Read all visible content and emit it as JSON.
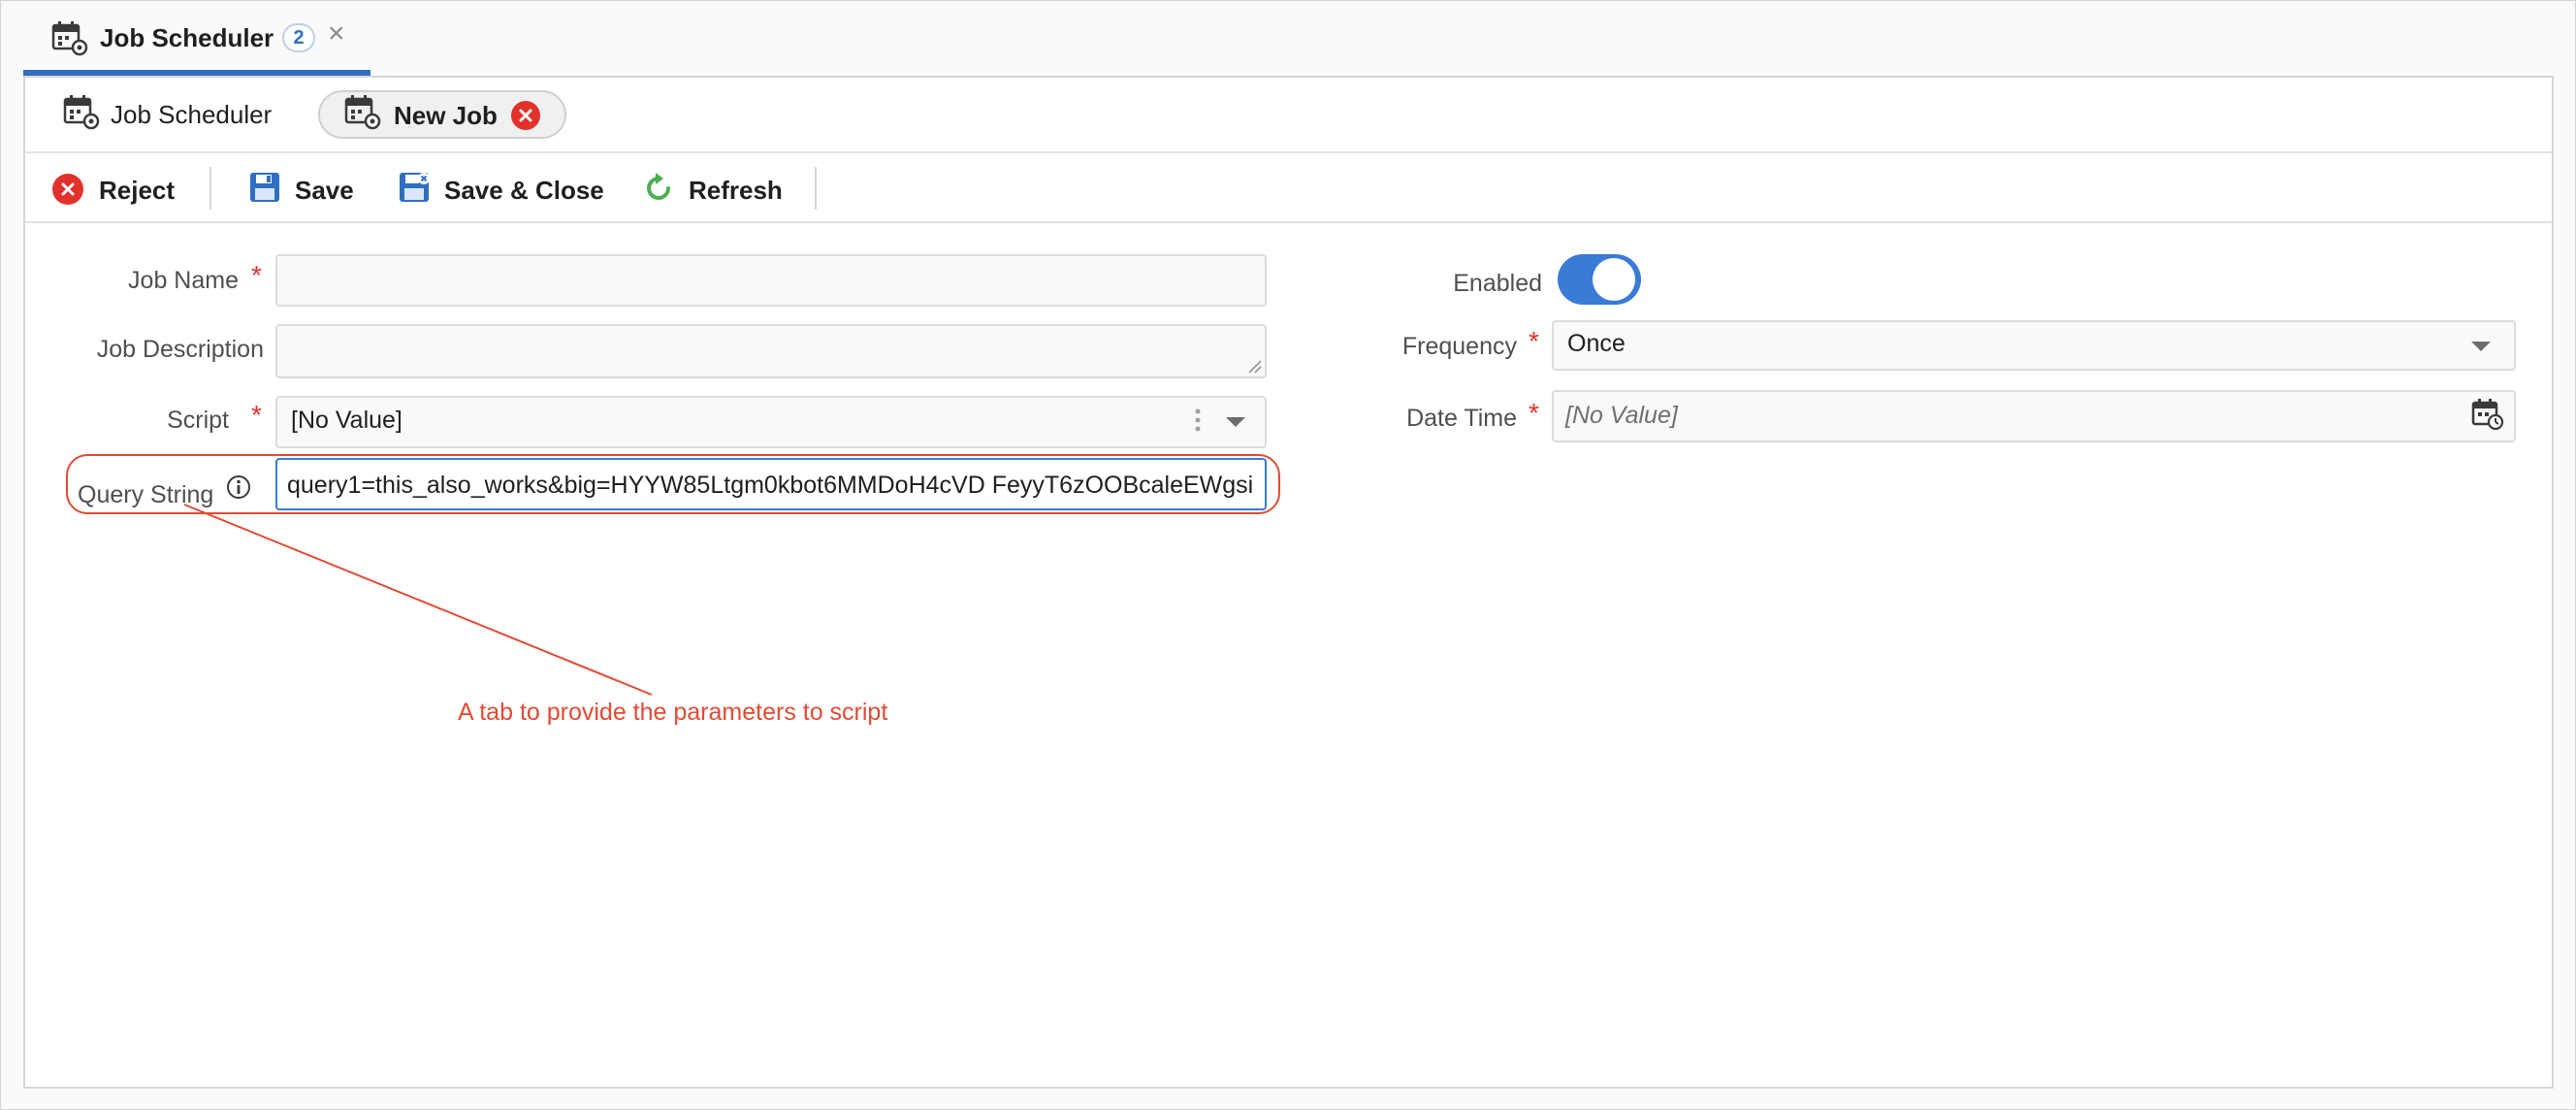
{
  "document_tab": {
    "title": "Job Scheduler",
    "badge_count": "2",
    "close_glyph": "×",
    "icon": "calendar-gear-icon"
  },
  "sub_tabs": [
    {
      "label": "Job Scheduler",
      "icon": "calendar-gear-icon",
      "active": false
    },
    {
      "label": "New Job",
      "icon": "calendar-gear-icon",
      "active": true,
      "closable": true
    }
  ],
  "toolbar": {
    "reject_label": "Reject",
    "save_label": "Save",
    "save_close_label": "Save & Close",
    "refresh_label": "Refresh"
  },
  "form": {
    "job_name": {
      "label": "Job Name",
      "required": "*",
      "value": ""
    },
    "job_description": {
      "label": "Job Description",
      "value": ""
    },
    "script": {
      "label": "Script",
      "required": "*",
      "value": "[No Value]"
    },
    "query_string": {
      "label": "Query String",
      "value": "query1=this_also_works&big=HYYW85Ltgm0kbot6MMDoH4cVD FeyyT6zOOBcaleEWgsi"
    },
    "enabled": {
      "label": "Enabled",
      "value": true
    },
    "frequency": {
      "label": "Frequency",
      "required": "*",
      "value": "Once"
    },
    "date_time": {
      "label": "Date Time",
      "required": "*",
      "placeholder": "[No Value]"
    }
  },
  "annotation": {
    "text": "A tab to provide the parameters to script"
  },
  "colors": {
    "accent": "#2f6fc2",
    "toggle_on": "#3a7bd5",
    "danger": "#e0312b",
    "annotation": "#e24a33",
    "refresh_green": "#4caf50"
  }
}
